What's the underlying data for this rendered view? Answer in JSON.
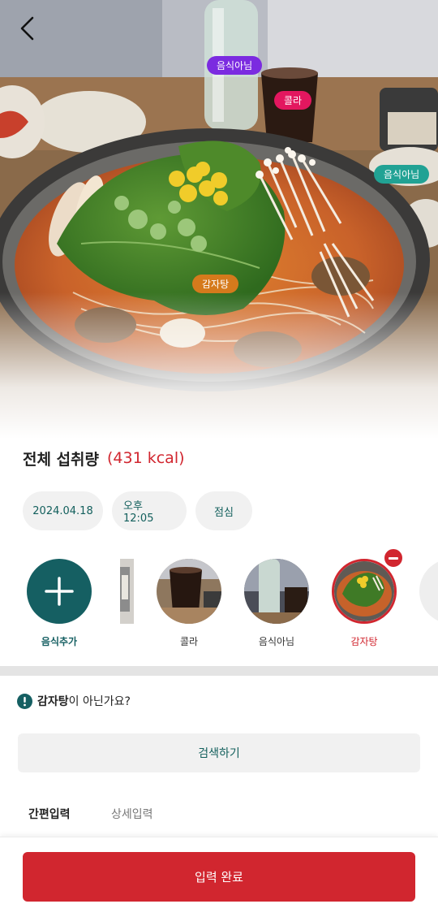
{
  "photo_tags": {
    "not_food_1": "음식아님",
    "cola": "콜라",
    "not_food_2": "음식아님",
    "gamjatang": "감자탕"
  },
  "intake": {
    "title": "전체 섭취량",
    "kcal": "(431 kcal)"
  },
  "chips": {
    "date": "2024.04.18",
    "time": "오후 12:05",
    "meal": "점심"
  },
  "foods": {
    "add_label": "음식추가",
    "items": [
      {
        "label": "콜라"
      },
      {
        "label": "음식아님"
      },
      {
        "label": "감자탕",
        "selected": true
      }
    ]
  },
  "not_this": {
    "food": "감자탕",
    "question": "이 아닌가요?"
  },
  "search_label": "검색하기",
  "tabs": {
    "simple": "간편입력",
    "detail": "상세입력"
  },
  "submit_label": "입력 완료",
  "colors": {
    "accent_red": "#d1262f",
    "teal": "#155f62",
    "tag_purple": "#7b2be0",
    "tag_pink": "#e3175f",
    "tag_teal": "#21a294",
    "tag_orange": "#d57a1c"
  },
  "icons": {
    "back": "chevron-left-icon",
    "add": "plus-icon",
    "remove": "minus-circle-icon",
    "alert": "exclamation-circle-icon"
  }
}
